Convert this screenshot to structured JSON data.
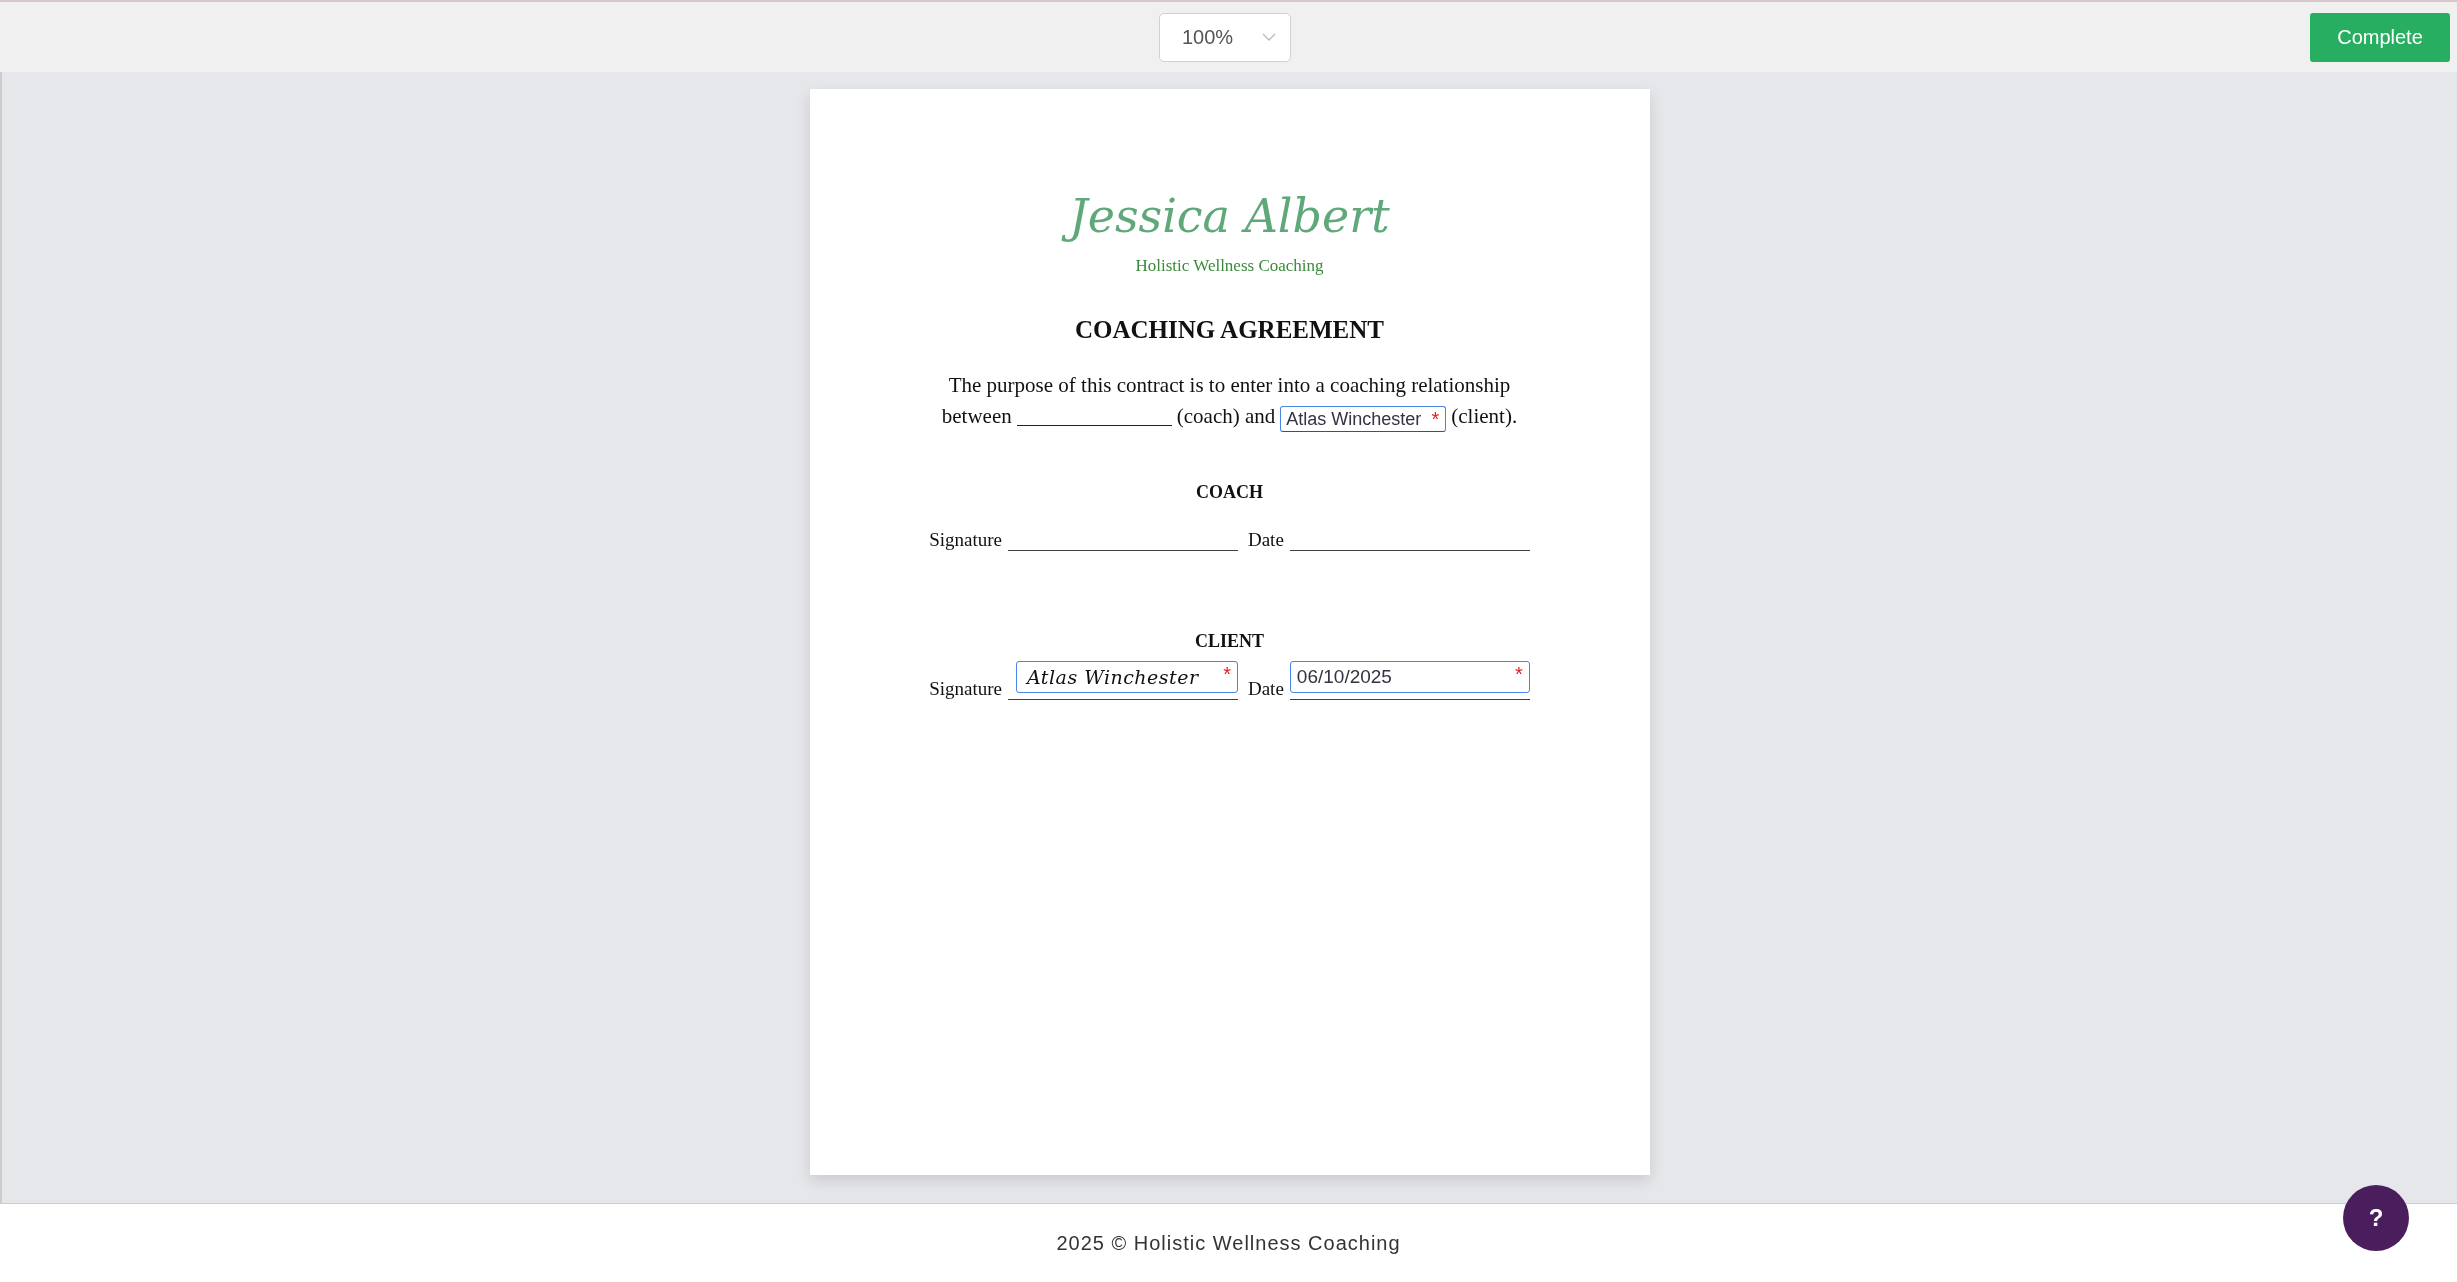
{
  "toolbar": {
    "zoom": "100%",
    "complete_button": "Complete"
  },
  "document": {
    "logo": {
      "name": "Jessica Albert",
      "tagline": "Holistic Wellness Coaching"
    },
    "title": "COACHING AGREEMENT",
    "intro": [
      [
        {
          "kind": "text",
          "text": "The purpose of this contract is to enter into a coaching relationship"
        }
      ],
      [
        {
          "kind": "text",
          "text": "between"
        },
        {
          "kind": "blank"
        },
        {
          "kind": "text",
          "text": "(coach) and"
        },
        {
          "kind": "field",
          "value": "Atlas Winchester",
          "marker": "*"
        },
        {
          "kind": "text",
          "text": "(client)."
        }
      ]
    ],
    "sections": [
      {
        "heading": "COACH",
        "signature": {
          "label": "Signature"
        },
        "date": {
          "label": "Date"
        }
      },
      {
        "heading": "CLIENT",
        "signature": {
          "label": "Signature",
          "value": "Atlas Winchester",
          "marker": "*"
        },
        "date": {
          "label": "Date",
          "value": "06/10/2025",
          "marker": "*"
        }
      }
    ]
  },
  "footer": {
    "text": "2025 © Holistic Wellness Coaching",
    "help_button": "?"
  }
}
